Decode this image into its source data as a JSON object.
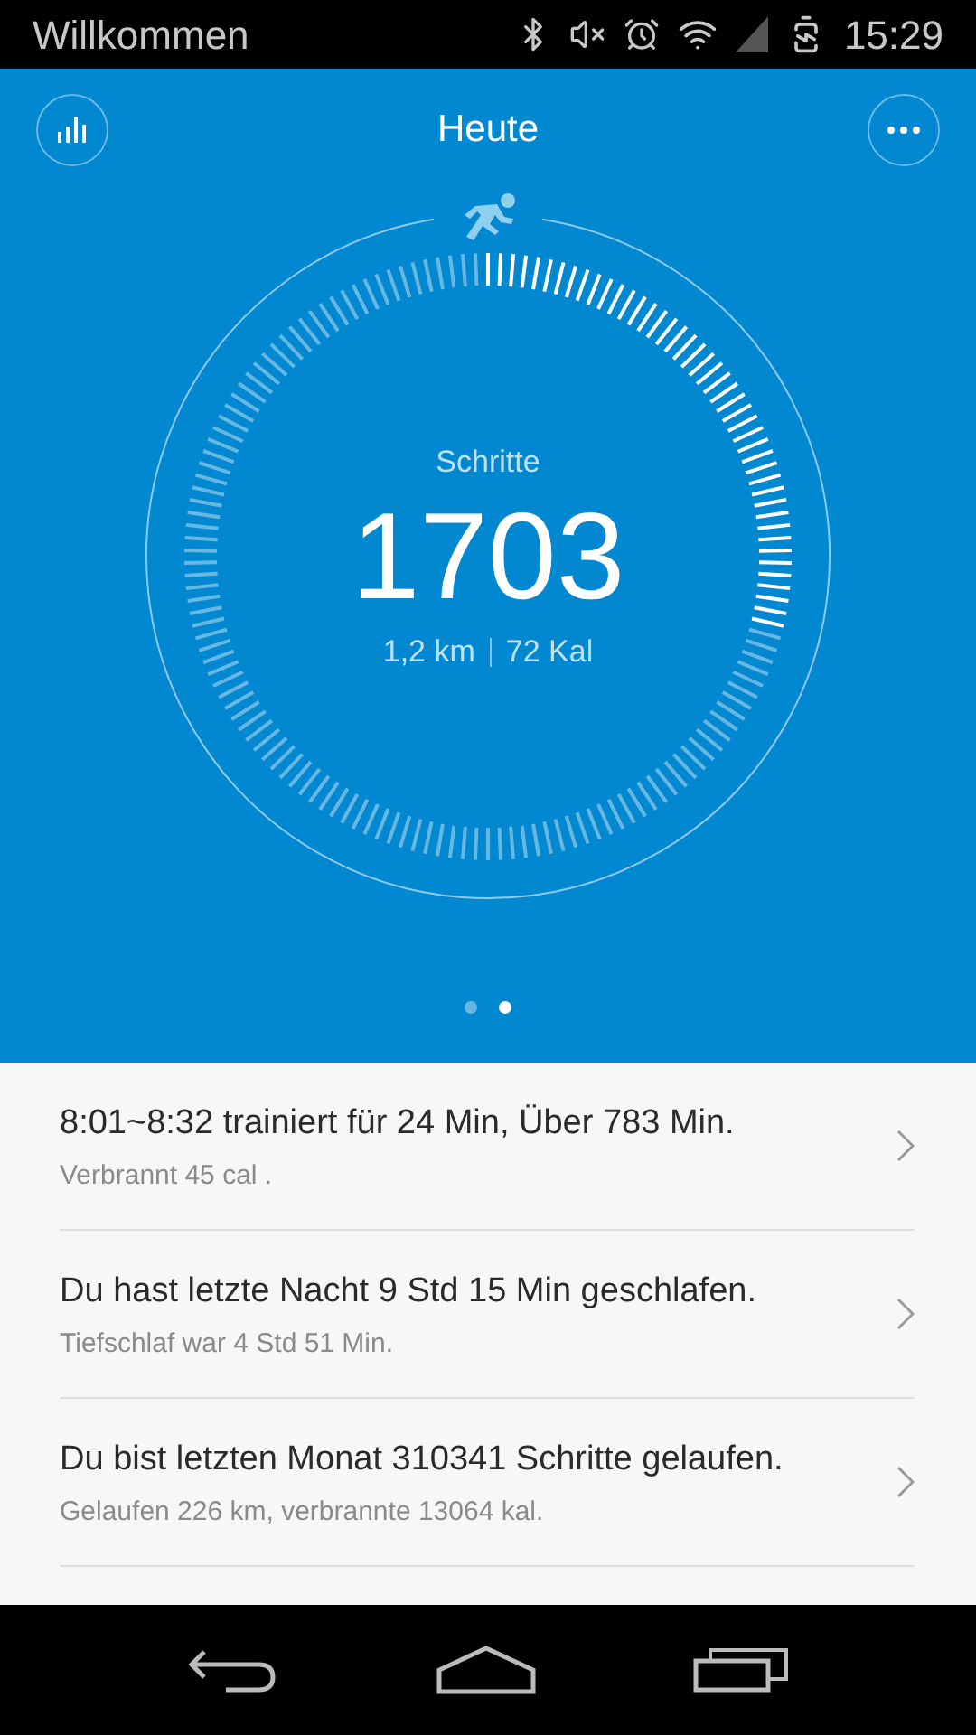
{
  "status_bar": {
    "title": "Willkommen",
    "time": "15:29"
  },
  "header": {
    "title": "Heute"
  },
  "ring": {
    "label": "Schritte",
    "steps": "1703",
    "distance": "1,2 km",
    "calories": "72 Kal"
  },
  "pages": [
    {
      "selected": false
    },
    {
      "selected": true
    }
  ],
  "entries": [
    {
      "title": "8:01~8:32  trainiert für 24 Min, Über 783 Min.",
      "subtitle": "Verbrannt 45 cal ."
    },
    {
      "title": "Du hast letzte Nacht 9 Std 15 Min geschlafen.",
      "subtitle": "Tiefschlaf war 4 Std 51 Min."
    },
    {
      "title": "Du bist letzten Monat 310341 Schritte gelaufen.",
      "subtitle": "Gelaufen 226 km, verbrannte 13064 kal."
    }
  ]
}
